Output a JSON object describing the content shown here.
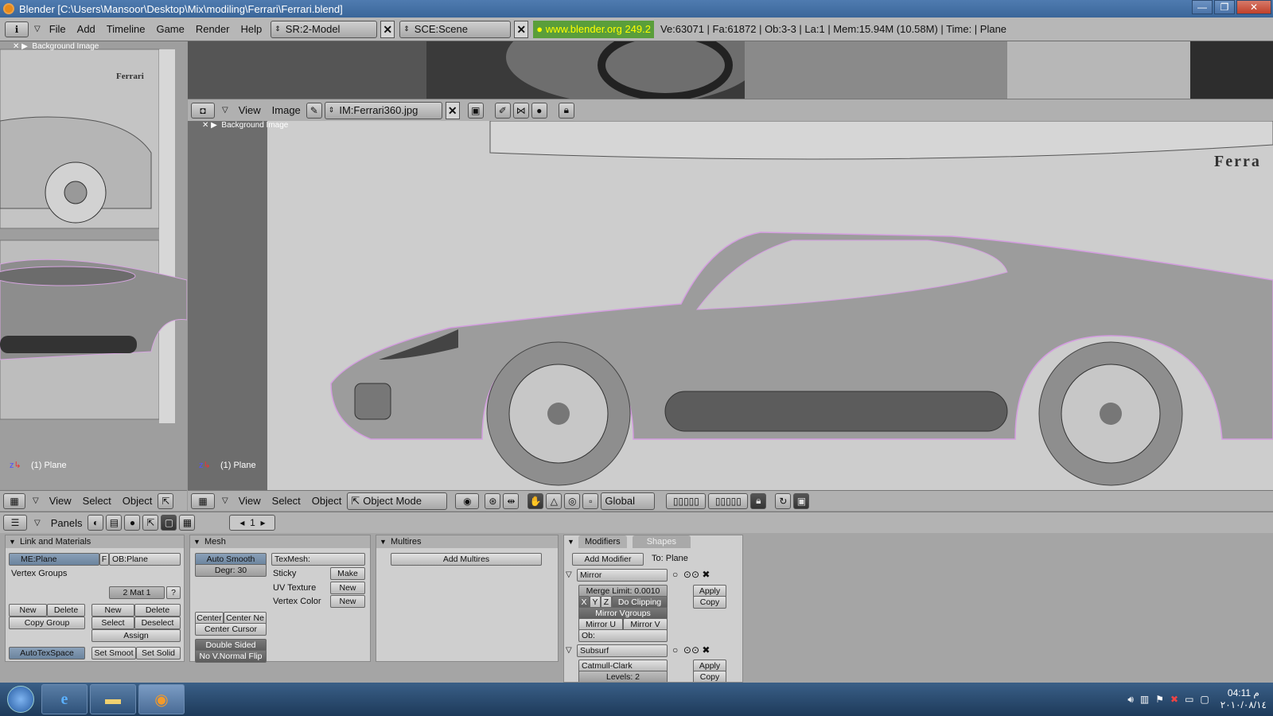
{
  "window": {
    "title": "Blender [C:\\Users\\Mansoor\\Desktop\\Mix\\modiling\\Ferrari\\Ferrari.blend]",
    "min": "—",
    "max": "❐",
    "close": "✕"
  },
  "main_header": {
    "menus": [
      "File",
      "Add",
      "Timeline",
      "Game",
      "Render",
      "Help"
    ],
    "screen": "SR:2-Model",
    "scene": "SCE:Scene",
    "link": "www.blender.org 249.2",
    "stats": "Ve:63071 | Fa:61872 | Ob:3-3 | La:1  | Mem:15.94M (10.58M)  | Time: | Plane"
  },
  "left_viewport": {
    "bg_label": "Background Image",
    "object_label": "(1) Plane",
    "brand": "Ferrari",
    "menus": [
      "View",
      "Select",
      "Object"
    ]
  },
  "image_editor": {
    "menus": [
      "View",
      "Image"
    ],
    "image_name": "IM:Ferrari360.jpg"
  },
  "main_viewport": {
    "bg_label": "Background Image",
    "object_label": "(1) Plane",
    "brand": "Ferra",
    "menus": [
      "View",
      "Select",
      "Object"
    ],
    "mode": "Object Mode",
    "orientation": "Global"
  },
  "buttons_header": {
    "panels_label": "Panels",
    "frame": "1"
  },
  "link_materials": {
    "title": "Link and Materials",
    "mesh": "ME:Plane",
    "f": "F",
    "ob": "OB:Plane",
    "vertex_groups": "Vertex Groups",
    "mat": "2 Mat 1",
    "q": "?",
    "new": "New",
    "delete": "Delete",
    "copy_group": "Copy Group",
    "new2": "New",
    "delete2": "Delete",
    "select": "Select",
    "deselect": "Deselect",
    "assign": "Assign",
    "autotex": "AutoTexSpace",
    "set_smooth": "Set Smoot",
    "set_solid": "Set Solid"
  },
  "mesh": {
    "title": "Mesh",
    "auto_smooth": "Auto Smooth",
    "degr": "Degr: 30",
    "texmesh": "TexMesh:",
    "sticky": "Sticky",
    "make": "Make",
    "uv_texture": "UV Texture",
    "uv_new": "New",
    "vertex_color": "Vertex Color",
    "vc_new": "New",
    "center": "Center",
    "center_new": "Center Ne",
    "center_cursor": "Center Cursor",
    "double_sided": "Double Sided",
    "no_vnormal": "No V.Normal Flip"
  },
  "multires": {
    "title": "Multires",
    "add": "Add Multires"
  },
  "modifiers": {
    "tab1": "Modifiers",
    "tab2": "Shapes",
    "add": "Add Modifier",
    "to": "To: Plane",
    "mirror": {
      "name": "Mirror",
      "merge": "Merge Limit: 0.0010",
      "x": "X",
      "y": "Y",
      "z": "Z",
      "clip": "Do Clipping",
      "vgroups": "Mirror Vgroups",
      "mu": "Mirror U",
      "mv": "Mirror V",
      "ob": "Ob:",
      "apply": "Apply",
      "copy": "Copy"
    },
    "subsurf": {
      "name": "Subsurf",
      "type": "Catmull-Clark",
      "levels": "Levels: 2",
      "apply": "Apply",
      "copy": "Copy"
    }
  },
  "taskbar": {
    "time": "04:11 م",
    "date": "٢٠١٠/٠٨/١٤"
  }
}
